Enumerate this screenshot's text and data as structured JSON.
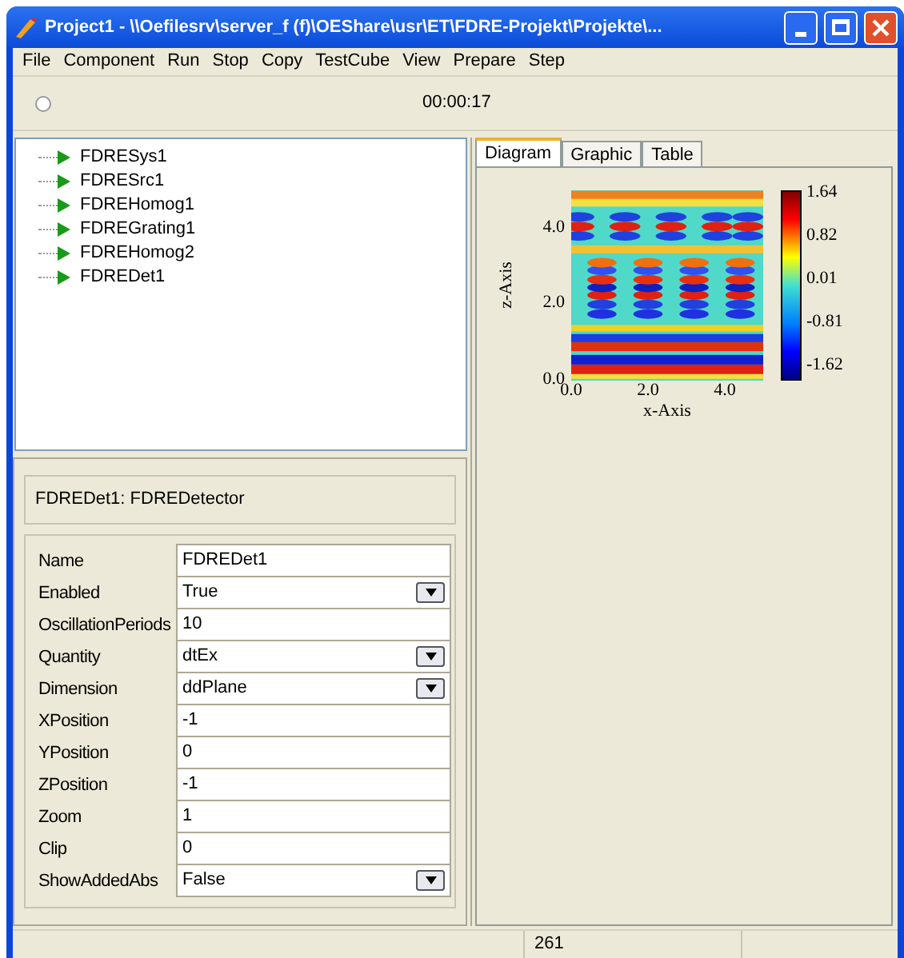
{
  "window": {
    "title": "Project1 - \\\\Oefilesrv\\server_f (f)\\OEShare\\usr\\ET\\FDRE-Projekt\\Projekte\\..."
  },
  "menu": [
    "File",
    "Component",
    "Run",
    "Stop",
    "Copy",
    "TestCube",
    "View",
    "Prepare",
    "Step"
  ],
  "toolbar": {
    "time": "00:00:17"
  },
  "tree": {
    "items": [
      {
        "label": "FDRESys1"
      },
      {
        "label": "FDRESrc1"
      },
      {
        "label": "FDREHomog1"
      },
      {
        "label": "FDREGrating1"
      },
      {
        "label": "FDREHomog2"
      },
      {
        "label": "FDREDet1"
      }
    ]
  },
  "properties": {
    "header": "FDREDet1: FDREDetector",
    "rows": [
      {
        "label": "Name",
        "value": "FDREDet1",
        "kind": "text"
      },
      {
        "label": "Enabled",
        "value": "True",
        "kind": "dropdown"
      },
      {
        "label": "OscillationPeriods",
        "value": "10",
        "kind": "text"
      },
      {
        "label": "Quantity",
        "value": "dtEx",
        "kind": "dropdown"
      },
      {
        "label": "Dimension",
        "value": "ddPlane",
        "kind": "dropdown"
      },
      {
        "label": "XPosition",
        "value": "-1",
        "kind": "text"
      },
      {
        "label": "YPosition",
        "value": "0",
        "kind": "text"
      },
      {
        "label": "ZPosition",
        "value": "-1",
        "kind": "text"
      },
      {
        "label": "Zoom",
        "value": "1",
        "kind": "text"
      },
      {
        "label": "Clip",
        "value": "0",
        "kind": "text"
      },
      {
        "label": "ShowAddedAbs",
        "value": "False",
        "kind": "dropdown"
      }
    ]
  },
  "tabs": [
    {
      "label": "Diagram",
      "selected": true
    },
    {
      "label": "Graphic",
      "selected": false
    },
    {
      "label": "Table",
      "selected": false
    }
  ],
  "diagram": {
    "y_axis_label": "z-Axis",
    "x_axis_label": "x-Axis",
    "y_ticks": [
      "4.0",
      "2.0",
      "0.0"
    ],
    "x_ticks": [
      "0.0",
      "2.0",
      "4.0"
    ],
    "colorbar_labels": [
      "1.64",
      "0.82",
      "0.01",
      "-0.81",
      "-1.62"
    ]
  },
  "status_bar": {
    "cell_2": "261"
  }
}
